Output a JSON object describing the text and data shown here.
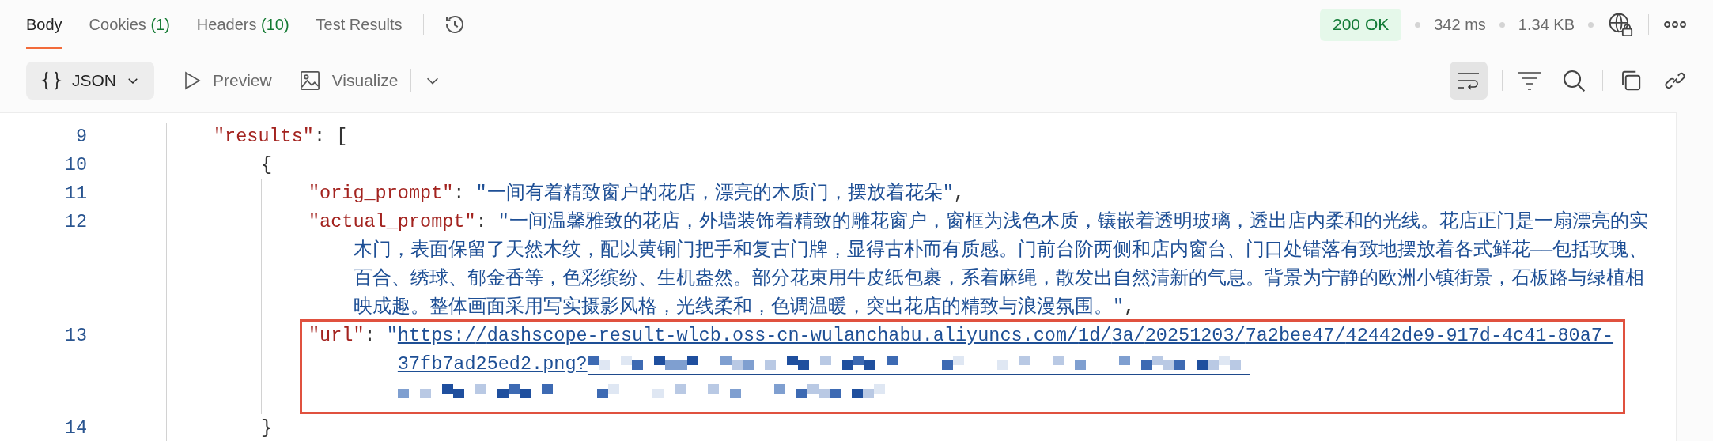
{
  "tabs": [
    {
      "label": "Body",
      "selected": true
    },
    {
      "label": "Cookies",
      "count": "(1)",
      "selected": false
    },
    {
      "label": "Headers",
      "count": "(10)",
      "selected": false
    },
    {
      "label": "Test Results",
      "selected": false
    }
  ],
  "status": {
    "code": "200 OK",
    "time": "342 ms",
    "size": "1.34 KB"
  },
  "toolbar": {
    "format": "JSON",
    "preview": "Preview",
    "visualize": "Visualize",
    "wrap_lines": true
  },
  "code_lines": [
    {
      "number": "9",
      "highlighted": false,
      "tokens": [
        {
          "kind": "key",
          "text": "\"results\""
        },
        {
          "kind": "punct",
          "text": ": ["
        }
      ]
    },
    {
      "number": "10",
      "highlighted": false,
      "tokens": [
        {
          "kind": "punct",
          "text": "{"
        }
      ]
    },
    {
      "number": "11",
      "highlighted": false,
      "tokens": [
        {
          "kind": "key",
          "text": "\"orig_prompt\""
        },
        {
          "kind": "punct",
          "text": ": "
        },
        {
          "kind": "string",
          "text": "\"一间有着精致窗户的花店，漂亮的木质门，摆放着花朵\""
        },
        {
          "kind": "punct",
          "text": ","
        }
      ]
    },
    {
      "number": "12",
      "highlighted": false,
      "tokens": [
        {
          "kind": "key",
          "text": "\"actual_prompt\""
        },
        {
          "kind": "punct",
          "text": ": "
        },
        {
          "kind": "string",
          "text": "\"一间温馨雅致的花店，外墙装饰着精致的雕花窗户，窗框为浅色木质，镶嵌着透明玻璃，透出店内柔和的光线。花店正门是一扇漂亮的实木门，表面保留了天然木纹，配以黄铜门把手和复古门牌，显得古朴而有质感。门前台阶两侧和店内窗台、门口处错落有致地摆放着各式鲜花——包括玫瑰、百合、绣球、郁金香等，色彩缤纷、生机盎然。部分花束用牛皮纸包裹，系着麻绳，散发出自然清新的气息。背景为宁静的欧洲小镇街景，石板路与绿植相映成趣。整体画面采用写实摄影风格，光线柔和，色调温暖，突出花店的精致与浪漫氛围。\""
        },
        {
          "kind": "punct",
          "text": ","
        }
      ]
    },
    {
      "number": "13",
      "highlighted": true,
      "tokens": [
        {
          "kind": "key",
          "text": "\"url\""
        },
        {
          "kind": "punct",
          "text": ": "
        },
        {
          "kind": "string",
          "text": "\""
        },
        {
          "kind": "link",
          "text": "https://dashscope-result-wlcb.oss-cn-wulanchabu.aliyuncs.com/1d/3a/20251203/7a2bee47/42442de9-917d-4c41-80a7-37fb7ad25ed2.png?",
          "redacted": true
        }
      ]
    },
    {
      "number": "14",
      "highlighted": false,
      "tokens": [
        {
          "kind": "punct",
          "text": "}"
        }
      ]
    }
  ]
}
